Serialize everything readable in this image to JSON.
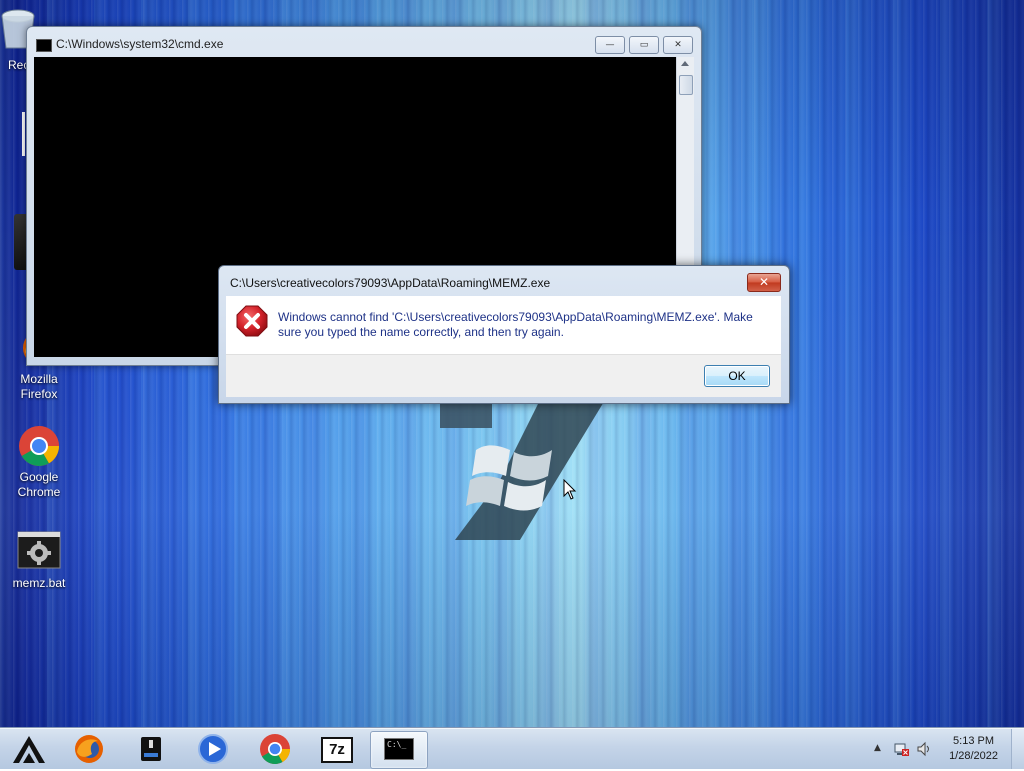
{
  "desktop": {
    "icons": [
      {
        "label": "Rec"
      },
      {
        "label": "Mozilla Firefox"
      },
      {
        "label": "Google Chrome"
      },
      {
        "label": "memz.bat"
      }
    ]
  },
  "cmd_window": {
    "title": "C:\\Windows\\system32\\cmd.exe",
    "minimize_glyph": "—",
    "maximize_glyph": "▭",
    "close_glyph": "✕"
  },
  "error_dialog": {
    "title": "C:\\Users\\creativecolors79093\\AppData\\Roaming\\MEMZ.exe",
    "close_glyph": "✕",
    "message": "Windows cannot find 'C:\\Users\\creativecolors79093\\AppData\\Roaming\\MEMZ.exe'. Make sure you typed the name correctly, and then try again.",
    "ok_label": "OK"
  },
  "taskbar": {
    "items": [
      {
        "icon": "start-logo-icon"
      },
      {
        "icon": "firefox-icon"
      },
      {
        "icon": "drive-icon"
      },
      {
        "icon": "media-player-icon"
      },
      {
        "icon": "chrome-icon"
      },
      {
        "icon": "7zip-icon",
        "text": "7z"
      },
      {
        "icon": "cmd-icon",
        "text": "C:\\_",
        "active": true
      }
    ],
    "tray": {
      "time": "5:13 PM",
      "date": "1/28/2022"
    }
  },
  "colors": {
    "error_red": "#d4232b",
    "message_blue": "#1e3287",
    "ok_border": "#3c7fb1"
  }
}
